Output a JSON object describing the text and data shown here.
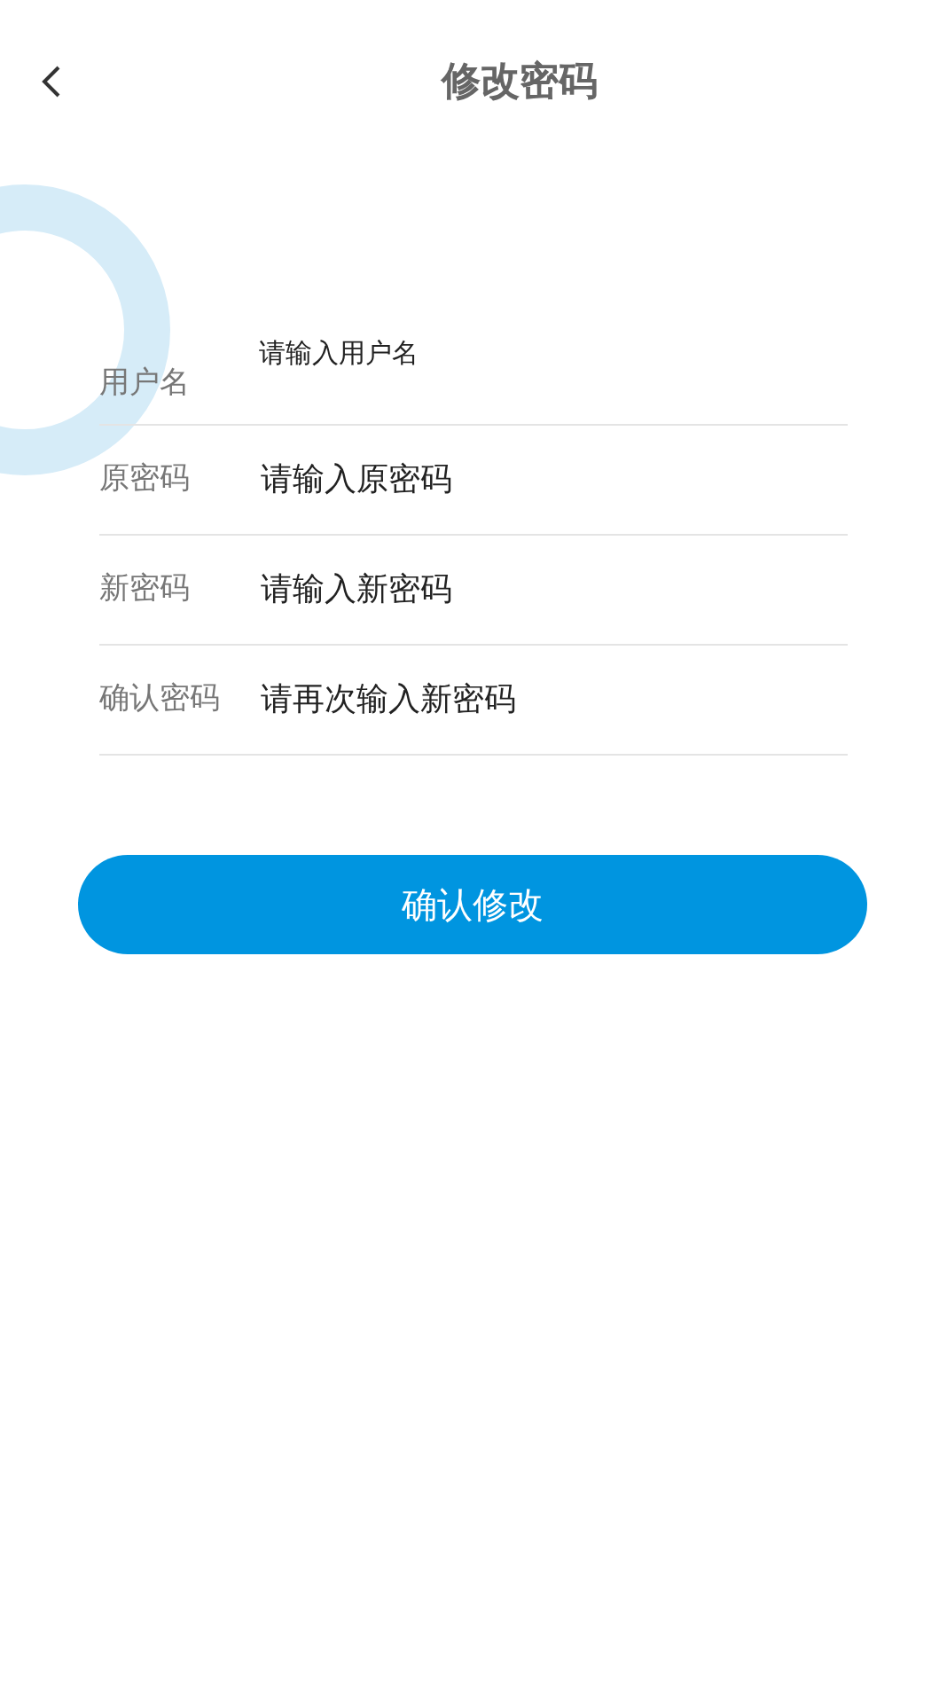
{
  "header": {
    "title": "修改密码"
  },
  "fields": [
    {
      "kind": "raised",
      "label": "用户名",
      "placeholder": "请输入用户名"
    },
    {
      "kind": "inline",
      "label": "原密码",
      "placeholder": "请输入原密码"
    },
    {
      "kind": "inline",
      "label": "新密码",
      "placeholder": "请输入新密码"
    },
    {
      "kind": "inline",
      "label": "确认密码",
      "placeholder": "请再次输入新密码"
    }
  ],
  "submit_button": "确认修改"
}
